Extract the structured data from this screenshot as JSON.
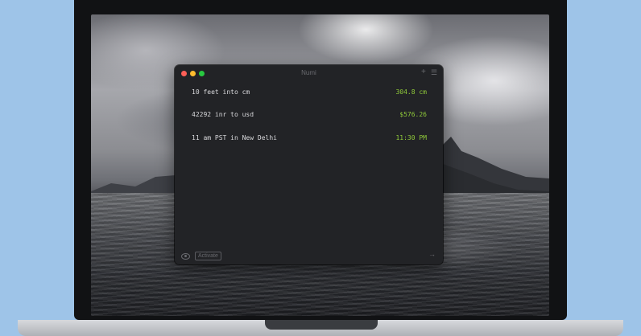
{
  "window": {
    "title": "Numi"
  },
  "toolbar": {
    "add_icon": "plus-icon",
    "menu_icon": "hamburger-menu-icon"
  },
  "rows": [
    {
      "expression": "10 feet into cm",
      "result": "304.8 cm"
    },
    {
      "expression": "42292 inr to usd",
      "result": "$576.26"
    },
    {
      "expression": "11 am PST in New Delhi",
      "result": "11:30 PM"
    }
  ],
  "footer": {
    "activate_label": "Activate",
    "visibility_icon": "eye-icon",
    "share_icon": "arrow-right-icon"
  },
  "colors": {
    "result_green": "#8fc93a",
    "window_bg": "#222326",
    "desktop_bg": "#9ec4e8"
  }
}
